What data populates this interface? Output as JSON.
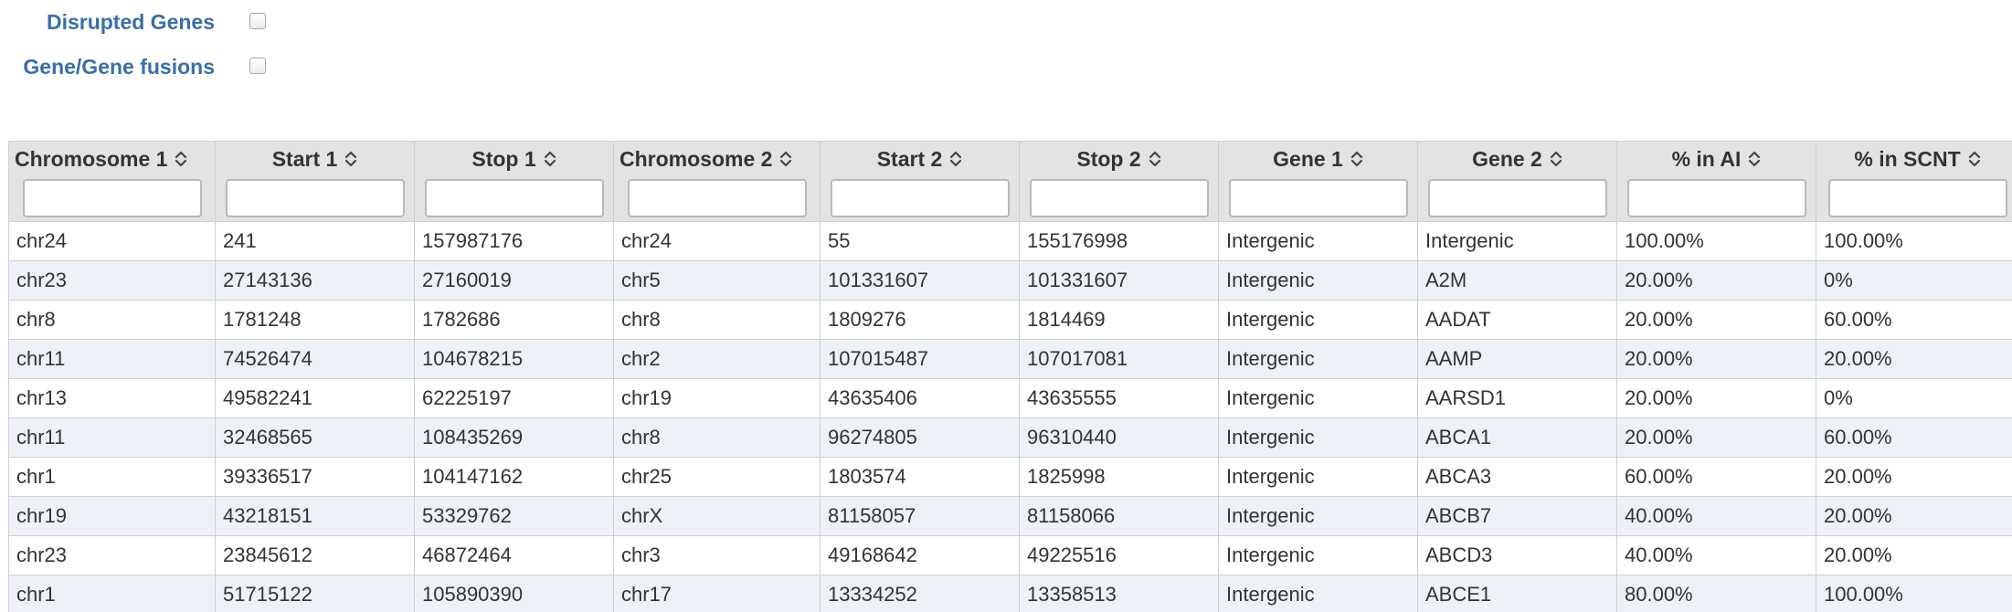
{
  "filters": [
    {
      "label": "Disrupted Genes",
      "checked": false
    },
    {
      "label": "Gene/Gene fusions",
      "checked": false
    }
  ],
  "table": {
    "columns": [
      {
        "label": "Chromosome 1",
        "filter_value": ""
      },
      {
        "label": "Start 1",
        "filter_value": ""
      },
      {
        "label": "Stop 1",
        "filter_value": ""
      },
      {
        "label": "Chromosome 2",
        "filter_value": ""
      },
      {
        "label": "Start 2",
        "filter_value": ""
      },
      {
        "label": "Stop 2",
        "filter_value": ""
      },
      {
        "label": "Gene 1",
        "filter_value": ""
      },
      {
        "label": "Gene 2",
        "filter_value": ""
      },
      {
        "label": "% in AI",
        "filter_value": ""
      },
      {
        "label": "% in SCNT",
        "filter_value": ""
      }
    ],
    "rows": [
      [
        "chr24",
        "241",
        "157987176",
        "chr24",
        "55",
        "155176998",
        "Intergenic",
        "Intergenic",
        "100.00%",
        "100.00%"
      ],
      [
        "chr23",
        "27143136",
        "27160019",
        "chr5",
        "101331607",
        "101331607",
        "Intergenic",
        "A2M",
        "20.00%",
        "0%"
      ],
      [
        "chr8",
        "1781248",
        "1782686",
        "chr8",
        "1809276",
        "1814469",
        "Intergenic",
        "AADAT",
        "20.00%",
        "60.00%"
      ],
      [
        "chr11",
        "74526474",
        "104678215",
        "chr2",
        "107015487",
        "107017081",
        "Intergenic",
        "AAMP",
        "20.00%",
        "20.00%"
      ],
      [
        "chr13",
        "49582241",
        "62225197",
        "chr19",
        "43635406",
        "43635555",
        "Intergenic",
        "AARSD1",
        "20.00%",
        "0%"
      ],
      [
        "chr11",
        "32468565",
        "108435269",
        "chr8",
        "96274805",
        "96310440",
        "Intergenic",
        "ABCA1",
        "20.00%",
        "60.00%"
      ],
      [
        "chr1",
        "39336517",
        "104147162",
        "chr25",
        "1803574",
        "1825998",
        "Intergenic",
        "ABCA3",
        "60.00%",
        "20.00%"
      ],
      [
        "chr19",
        "43218151",
        "53329762",
        "chrX",
        "81158057",
        "81158066",
        "Intergenic",
        "ABCB7",
        "40.00%",
        "20.00%"
      ],
      [
        "chr23",
        "23845612",
        "46872464",
        "chr3",
        "49168642",
        "49225516",
        "Intergenic",
        "ABCD3",
        "40.00%",
        "20.00%"
      ],
      [
        "chr1",
        "51715122",
        "105890390",
        "chr17",
        "13334252",
        "13358513",
        "Intergenic",
        "ABCE1",
        "80.00%",
        "100.00%"
      ]
    ]
  },
  "icons": {
    "sort": "sort-both-icon"
  },
  "colors": {
    "filter_label": "#3a6fa6",
    "header_bg": "#e3e3e3",
    "row_alt_bg": "#eef2f8"
  }
}
